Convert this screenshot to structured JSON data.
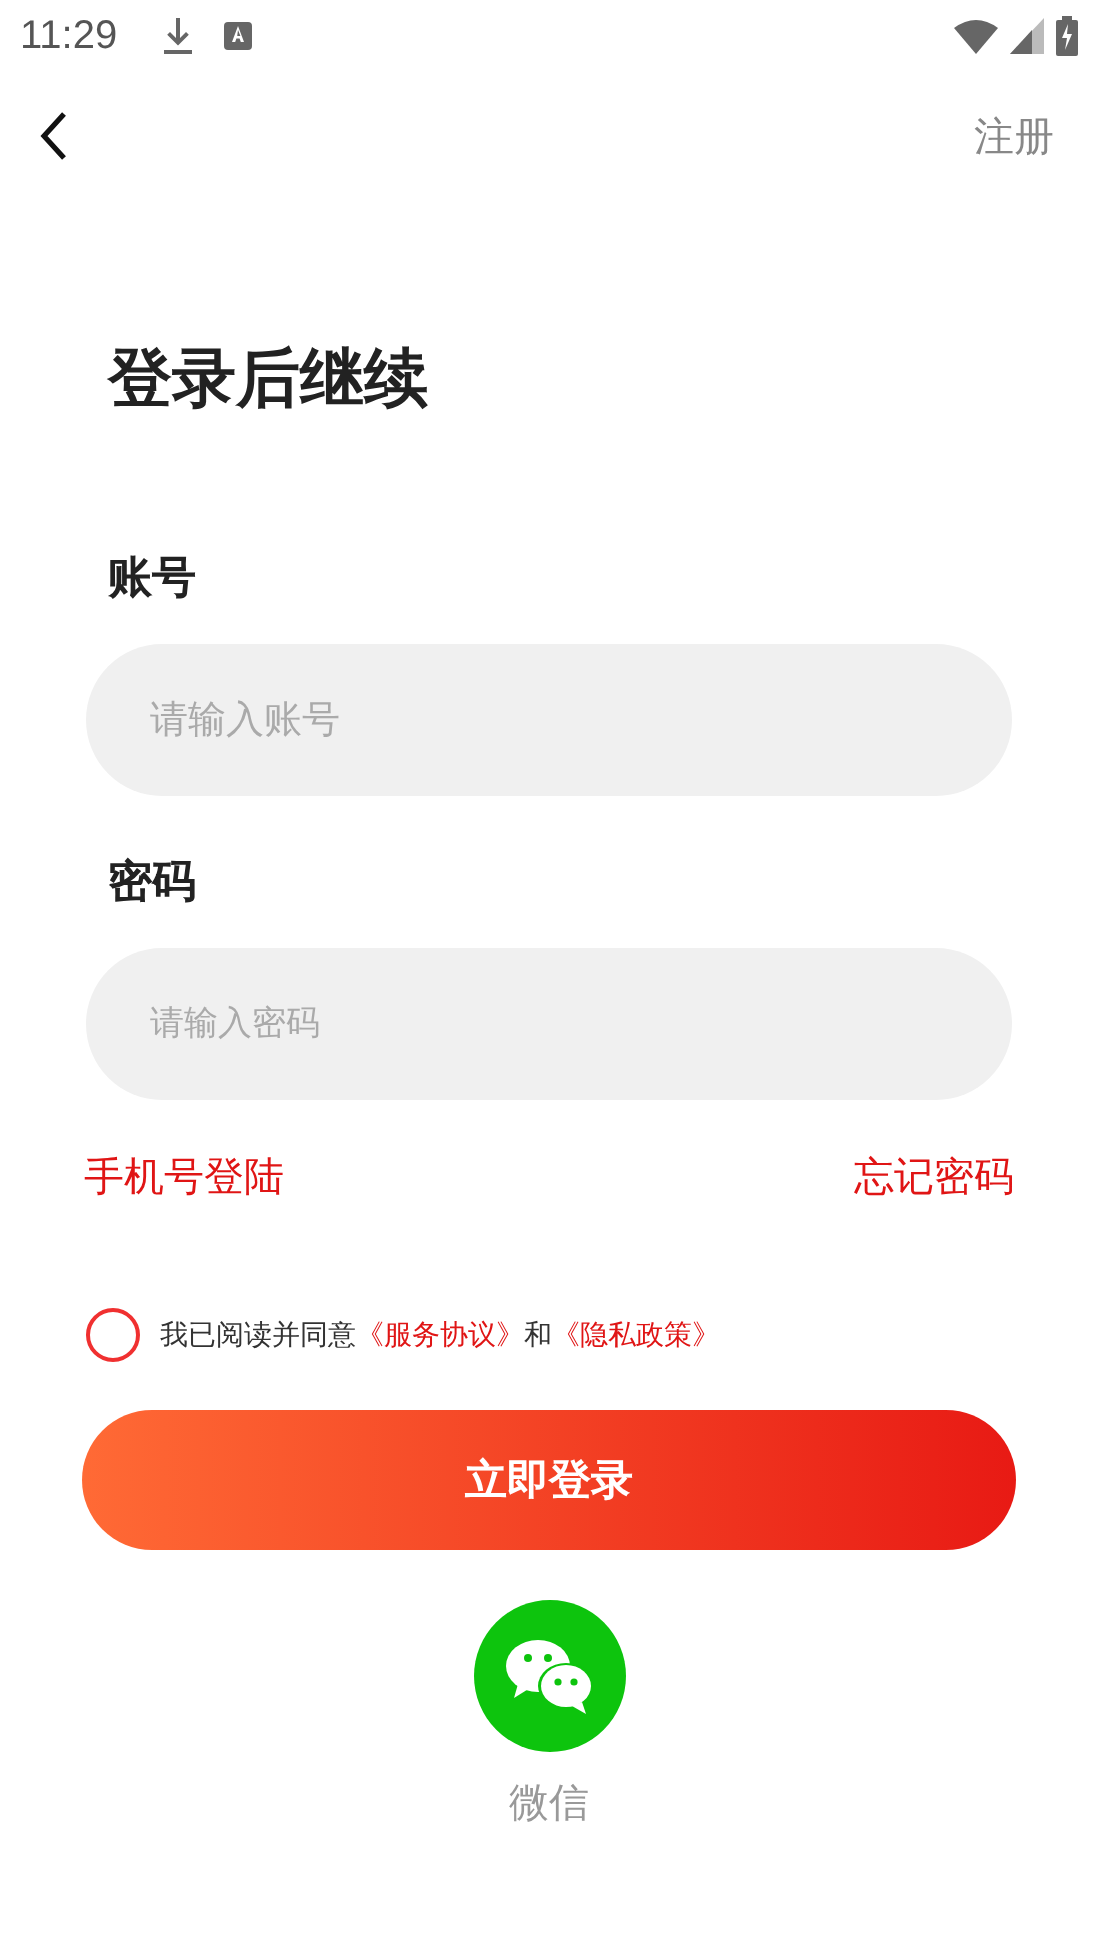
{
  "status_bar": {
    "time": "11:29"
  },
  "header": {
    "action": "注册"
  },
  "title": "登录后继续",
  "fields": [
    {
      "label": "账号",
      "placeholder": "请输入账号"
    },
    {
      "label": "密码",
      "placeholder": "请输入密码"
    }
  ],
  "links": {
    "left": "手机号登陆",
    "right": "忘记密码"
  },
  "agreement": {
    "checked": false,
    "text": "我已阅读并同意",
    "link_1": "《服务协议》",
    "joiner": "和",
    "link_2": "《隐私政策》"
  },
  "login_button": "立即登录",
  "social": {
    "label": "微信"
  }
}
